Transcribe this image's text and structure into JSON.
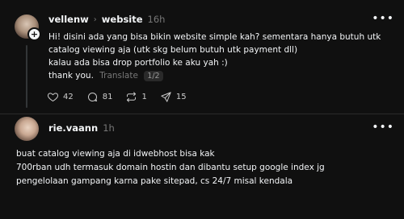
{
  "post1": {
    "username": "vellenw",
    "community": "website",
    "time": "16h",
    "lines": [
      "Hi! disini ada yang bisa bikin website simple kah? sementara hanya butuh utk",
      "catalog viewing aja (utk skg belum butuh utk payment dll)",
      "kalau ada bisa drop portfolio ke aku yah :)",
      "thank you."
    ],
    "translate_label": "Translate",
    "pager": "1/2",
    "likes": "42",
    "comments": "81",
    "reposts": "1",
    "shares": "15"
  },
  "post2": {
    "username": "rie.vaann",
    "time": "1h",
    "lines": [
      "buat catalog viewing aja di idwebhost bisa kak",
      "700rban udh termasuk domain hostin dan dibantu setup google index jg",
      "pengelolaan gampang karna pake sitepad, cs 24/7 misal kendala"
    ]
  },
  "icons": {
    "more": "more-horizontal-icon",
    "like": "heart-icon",
    "comment": "comment-icon",
    "repost": "repost-icon",
    "share": "send-icon",
    "follow": "plus-icon"
  }
}
